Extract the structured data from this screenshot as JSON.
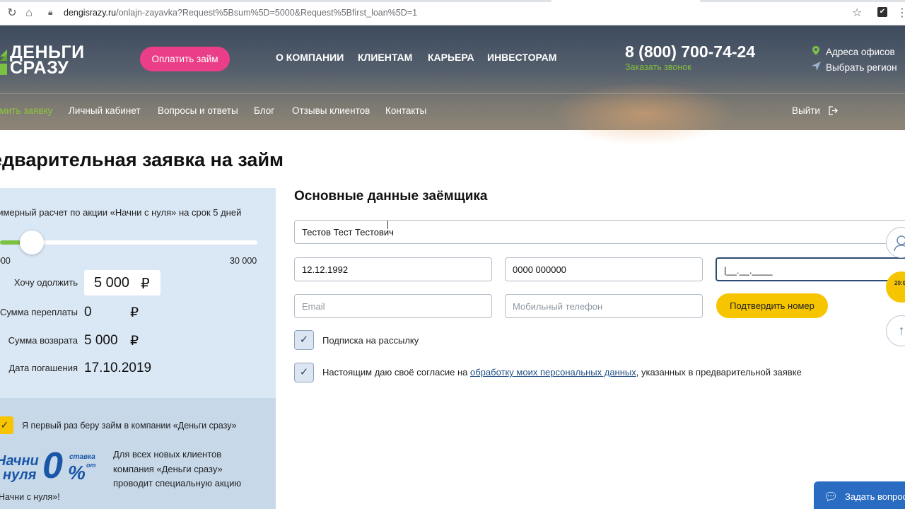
{
  "browser": {
    "url_host": "dengisrazy.ru",
    "url_path": "/onlajn-zayavka?Request%5Bsum%5D=5000&Request%5Bfirst_loan%5D=1"
  },
  "header": {
    "logo_line1": "ДЕНЬГИ",
    "logo_line2": "СРАЗУ",
    "pay_button": "Оплатить займ",
    "nav": [
      "О КОМПАНИИ",
      "КЛИЕНТАМ",
      "КАРЬЕРА",
      "ИНВЕСТОРАМ"
    ],
    "phone": "8 (800) 700-74-24",
    "callback": "Заказать звонок",
    "offices": "Адреса офисов",
    "region": "Выбрать регион",
    "subnav": [
      "имить заявку",
      "Личный кабинет",
      "Вопросы и ответы",
      "Блог",
      "Отзывы клиентов",
      "Контакты"
    ],
    "logout": "Выйти"
  },
  "page_title": "едварительная заявка на займ",
  "calculator": {
    "caption": "римерный расчет по акции «Начни с нуля» на срок 5 дней",
    "slider_min": "000",
    "slider_max": "30 000",
    "slider_fill_fraction": 0.0,
    "want_label": "Хочу одолжить",
    "want_value": "5 000",
    "currency": "₽",
    "overpay_label": "Сумма переплаты",
    "overpay_value": "0",
    "return_label": "Сумма возврата",
    "return_value": "5 000",
    "date_label": "Дата погашения",
    "date_value": "17.10.2019"
  },
  "promo": {
    "first_time_label": "Я первый раз беру займ в компании «Деньги сразу»",
    "logo_word1": "Начни",
    "logo_word2": "нуля",
    "logo_zero": "0",
    "logo_rate": "ставка",
    "logo_from": "от",
    "logo_pct": "%",
    "text": "Для всех новых клиентов компания «Деньги сразу» проводит специальную акцию",
    "cta": "Начни с нуля»!"
  },
  "form": {
    "title": "Основные данные заёмщика",
    "full_name": "Тестов Тест Тестович",
    "birth_date": "12.12.1992",
    "passport": "0000 000000",
    "issue_date_mask": "|__.__.____",
    "email_placeholder": "Email",
    "phone_placeholder": "Мобильный телефон",
    "confirm_button": "Подтвердить номер",
    "subscribe_label": "Подписка на рассылку",
    "consent_prefix": "Настоящим даю своё согласие на ",
    "consent_link": "обработку моих персональных данных",
    "consent_suffix": ", указанных в предварительной заявке"
  },
  "floating": {
    "badge_text": "20:00",
    "chat_label": "Задать вопрос"
  }
}
